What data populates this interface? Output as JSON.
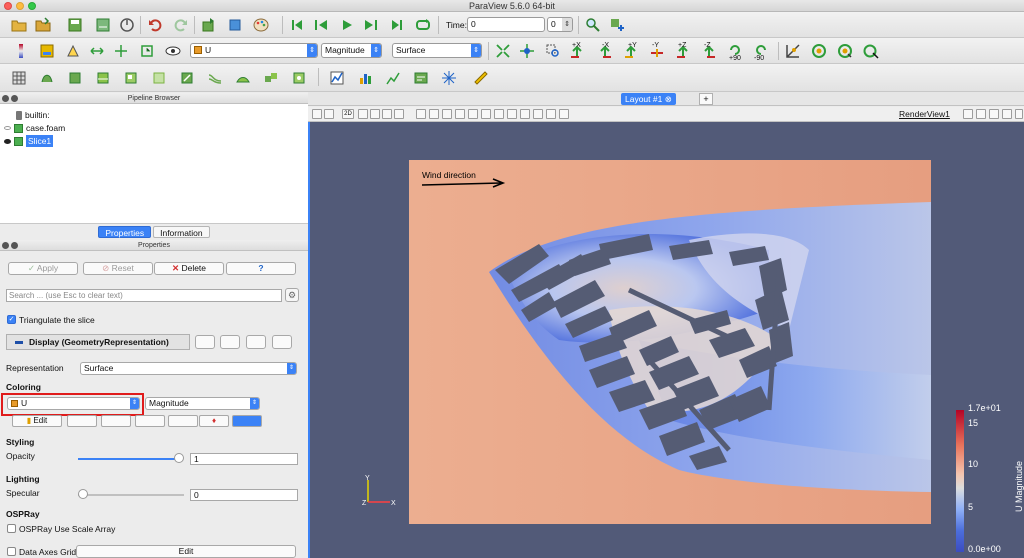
{
  "window": {
    "title": "ParaView 5.6.0 64-bit"
  },
  "toolbar": {
    "time_label": "Time:",
    "time_value": "0",
    "timestep_value": "0",
    "array_name": "U",
    "component": "Magnitude",
    "representation": "Surface",
    "camera_labels": [
      "+X",
      "-X",
      "+Y",
      "-Y",
      "+Z",
      "-Z",
      "+90",
      "-90"
    ]
  },
  "pipeline": {
    "title": "Pipeline Browser",
    "items": [
      {
        "label": "builtin:"
      },
      {
        "label": "case.foam"
      },
      {
        "label": "Slice1"
      }
    ]
  },
  "tabs": [
    "Properties",
    "Information"
  ],
  "properties": {
    "title": "Properties",
    "apply": "Apply",
    "reset": "Reset",
    "delete": "Delete",
    "help": "?",
    "search_placeholder": "Search ... (use Esc to clear text)",
    "triangulate_label": "Triangulate the slice",
    "display_label": "Display (GeometryRepresentation)",
    "representation_label": "Representation",
    "representation_value": "Surface",
    "coloring_section": "Coloring",
    "coloring_array": "U",
    "coloring_component": "Magnitude",
    "edit_label": "Edit",
    "styling_section": "Styling",
    "opacity_label": "Opacity",
    "opacity_value": "1",
    "opacity_level": 1.0,
    "lighting_section": "Lighting",
    "specular_label": "Specular",
    "specular_value": "0",
    "specular_level": 0.0,
    "ospray_section": "OSPRay",
    "ospray_scale_label": "OSPRay Use Scale Array",
    "axes_grid_label": "Data Axes Grid",
    "axes_grid_edit": "Edit"
  },
  "layout": {
    "tab_label": "Layout #1",
    "view_name": "RenderView1",
    "two_d_label": "2D"
  },
  "render": {
    "annotation": "Wind direction",
    "axes": {
      "x": "X",
      "y": "Y",
      "z": "Z"
    },
    "colorbar": {
      "title": "U Magnitude",
      "max_label": "1.7e+01",
      "tick_15": "15",
      "tick_10": "10",
      "tick_5": "5",
      "min_label": "0.0e+00"
    },
    "colormap": [
      "#3b4cc0",
      "#dcdddd",
      "#b40426"
    ]
  }
}
